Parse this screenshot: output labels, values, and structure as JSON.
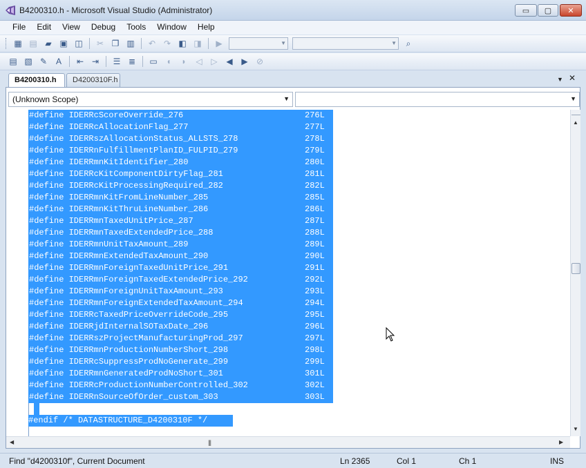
{
  "window": {
    "title": "B4200310.h - Microsoft Visual Studio (Administrator)",
    "controls": {
      "minimize": "▭",
      "maximize": "▢",
      "close": "✕"
    }
  },
  "menu": [
    "File",
    "Edit",
    "View",
    "Debug",
    "Tools",
    "Window",
    "Help"
  ],
  "tabs": {
    "active": "B4200310.h",
    "inactive": "D4200310F.h",
    "dropdown_glyph": "▼",
    "close_glyph": "✕"
  },
  "scope": {
    "left_value": "(Unknown Scope)",
    "right_value": ""
  },
  "code": {
    "define_lines": [
      {
        "text": "#define IDERRcScoreOverride_276",
        "value": "276L"
      },
      {
        "text": "#define IDERRcAllocationFlag_277",
        "value": "277L"
      },
      {
        "text": "#define IDERRszAllocationStatus_ALLSTS_278",
        "value": "278L"
      },
      {
        "text": "#define IDERRnFulfillmentPlanID_FULPID_279",
        "value": "279L"
      },
      {
        "text": "#define IDERRmnKitIdentifier_280",
        "value": "280L"
      },
      {
        "text": "#define IDERRcKitComponentDirtyFlag_281",
        "value": "281L"
      },
      {
        "text": "#define IDERRcKitProcessingRequired_282",
        "value": "282L"
      },
      {
        "text": "#define IDERRmnKitFromLineNumber_285",
        "value": "285L"
      },
      {
        "text": "#define IDERRmnKitThruLineNumber_286",
        "value": "286L"
      },
      {
        "text": "#define IDERRmnTaxedUnitPrice_287",
        "value": "287L"
      },
      {
        "text": "#define IDERRmnTaxedExtendedPrice_288",
        "value": "288L"
      },
      {
        "text": "#define IDERRmnUnitTaxAmount_289",
        "value": "289L"
      },
      {
        "text": "#define IDERRmnExtendedTaxAmount_290",
        "value": "290L"
      },
      {
        "text": "#define IDERRmnForeignTaxedUnitPrice_291",
        "value": "291L"
      },
      {
        "text": "#define IDERRmnForeignTaxedExtendedPrice_292",
        "value": "292L"
      },
      {
        "text": "#define IDERRmnForeignUnitTaxAmount_293",
        "value": "293L"
      },
      {
        "text": "#define IDERRmnForeignExtendedTaxAmount_294",
        "value": "294L"
      },
      {
        "text": "#define IDERRcTaxedPriceOverrideCode_295",
        "value": "295L"
      },
      {
        "text": "#define IDERRjdInternalSOTaxDate_296",
        "value": "296L"
      },
      {
        "text": "#define IDERRszProjectManufacturingProd_297",
        "value": "297L"
      },
      {
        "text": "#define IDERRmnProductionNumberShort_298",
        "value": "298L"
      },
      {
        "text": "#define IDERRcSuppressProdNoGenerate_299",
        "value": "299L"
      },
      {
        "text": "#define IDERRmnGeneratedProdNoShort_301",
        "value": "301L"
      },
      {
        "text": "#define IDERRcProductionNumberControlled_302",
        "value": "302L"
      },
      {
        "text": "#define IDERRnSourceOfOrder_custom_303",
        "value": "303L"
      }
    ],
    "endif_line": "#endif /* DATASTRUCTURE_D4200310F */"
  },
  "status": {
    "message": "Find \"d4200310f\", Current Document",
    "line": "Ln 2365",
    "col": "Col 1",
    "ch": "Ch 1",
    "mode": "INS"
  },
  "colors": {
    "selection": "#3399ff",
    "chrome": "#d8e3f0"
  }
}
